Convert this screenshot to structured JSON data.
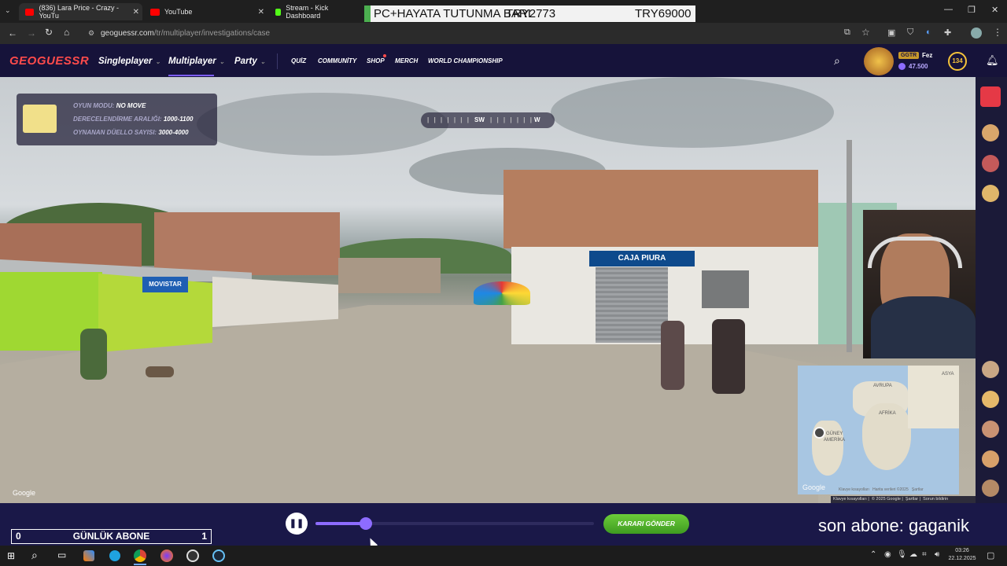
{
  "browser": {
    "tabs": [
      {
        "title": "(836) Lara Price - Crazy - YouTu",
        "favicon_color": "#ff0000"
      },
      {
        "title": "YouTube",
        "favicon_color": "#ff0000"
      },
      {
        "title": "Stream - Kick Dashboard",
        "favicon_color": "#53fc18"
      }
    ],
    "overlay_banner": {
      "left": "PC+HAYATA TUTUNMA BARI",
      "mid": "TRY2773",
      "right": "TRY69000"
    },
    "url_host": "geoguessr.com",
    "url_path": "/tr/multiplayer/investigations/case"
  },
  "nav": {
    "logo": "GEOGUESSR",
    "items": [
      "Singleplayer",
      "Multiplayer",
      "Party"
    ],
    "small_items": [
      "QUİZ",
      "COMMUNİTY",
      "SHOP",
      "MERCH",
      "WORLD CHAMPIONSHIP"
    ],
    "user_tag": "GGTR",
    "user_name": "Fez",
    "coins": "47.500",
    "level": "134"
  },
  "game": {
    "info": [
      {
        "label": "OYUN MODU:",
        "value": "NO MOVE"
      },
      {
        "label": "DERECELENDİRME ARALIĞI:",
        "value": "1000-1100"
      },
      {
        "label": "OYNANAN DÜELLO SAYISI:",
        "value": "3000-4000"
      }
    ],
    "compass": {
      "a": "SW",
      "b": "W"
    },
    "signs": {
      "caja": "CAJA PIURA",
      "movistar": "MOVISTAR"
    },
    "google_mark": "Google",
    "map_labels": {
      "avrupa": "AVRUPA",
      "afrika": "AFRİKA",
      "asya": "ASYA",
      "guney": "GÜNEY",
      "amerika": "AMERİKA"
    },
    "map_footer": [
      "Klavye kısayolları",
      "© 2025 Google",
      "Şartlar",
      "Sorun bildirin"
    ],
    "map_inner_footer": [
      "Klavye kısayolları",
      "Harita verileri ©2025",
      "Şartlar"
    ],
    "submit_label": "KARARI GÖNDER",
    "slider_value_pct": 18
  },
  "overlay": {
    "sub_counter": {
      "left": "0",
      "label": "GÜNLÜK ABONE",
      "right": "1"
    },
    "last_sub": "son abone: gaganik"
  },
  "taskbar": {
    "time": "03:26",
    "date": "22.12.2025"
  }
}
